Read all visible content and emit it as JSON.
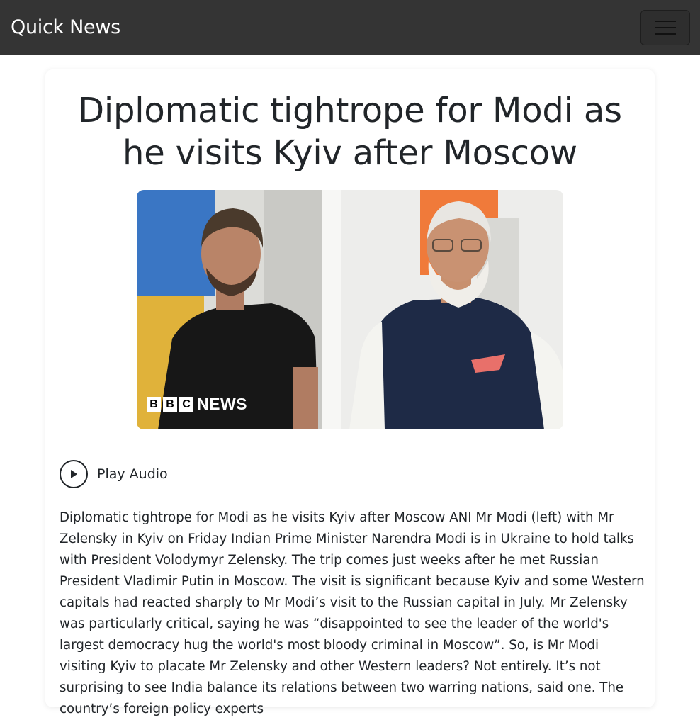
{
  "navbar": {
    "brand": "Quick News",
    "menu_icon": "hamburger-menu-icon"
  },
  "article": {
    "headline": "Diplomatic tightrope for Modi as he visits Kyiv after Moscow",
    "image": {
      "watermark_letters": [
        "B",
        "B",
        "C"
      ],
      "watermark_word": "NEWS"
    },
    "audio": {
      "icon": "play-circle-icon",
      "label": "Play Audio"
    },
    "body": "Diplomatic tightrope for Modi as he visits Kyiv after Moscow ANI Mr Modi (left) with Mr Zelensky in Kyiv on Friday Indian Prime Minister Narendra Modi is in Ukraine to hold talks with President Volodymyr Zelensky. The trip comes just weeks after he met Russian President Vladimir Putin in Moscow. The visit is significant because Kyiv and some Western capitals had reacted sharply to Mr Modi’s visit to the Russian capital in July. Mr Zelensky was particularly critical, saying he was “disappointed to see the leader of the world's largest democracy hug the world's most bloody criminal in Moscow”. So, is Mr Modi visiting Kyiv to placate Mr Zelensky and other Western leaders? Not entirely. It’s not surprising to see India balance its relations between two warring nations, said one. The country’s foreign policy experts"
  },
  "colors": {
    "navbar_bg": "#343434",
    "text": "#212529",
    "card_bg": "#ffffff"
  }
}
